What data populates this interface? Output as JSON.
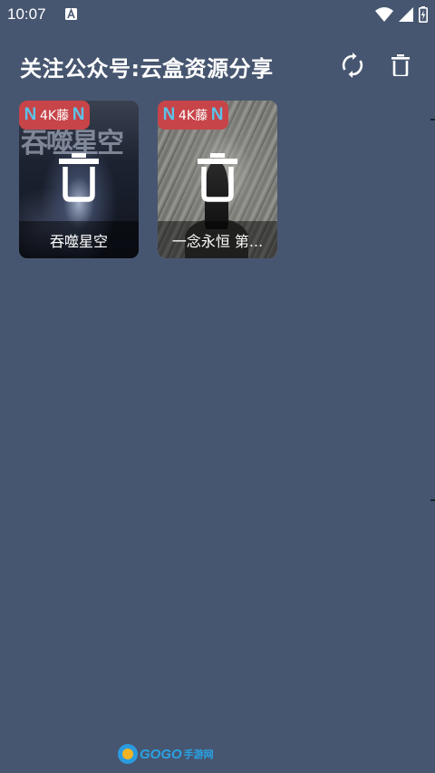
{
  "status_bar": {
    "time": "10:07",
    "icons": [
      "notification-a-icon",
      "wifi-icon",
      "signal-icon",
      "battery-charging-icon"
    ]
  },
  "toolbar": {
    "title": "关注公众号:云盒资源分享",
    "actions": [
      "refresh-icon",
      "delete-icon"
    ]
  },
  "cards": [
    {
      "badge_left": "N",
      "badge_text": "4K藤",
      "badge_right": "N",
      "poster_art_text": "吞噬星空",
      "title": "吞噬星空"
    },
    {
      "badge_left": "N",
      "badge_text": "4K藤",
      "badge_right": "N",
      "title": "一念永恒 第..."
    }
  ],
  "watermark": {
    "brand": "GOGO",
    "suffix": "手游网"
  },
  "colors": {
    "background": "#475670",
    "badge": "#c74449",
    "badge_n": "#5bc3e8"
  }
}
